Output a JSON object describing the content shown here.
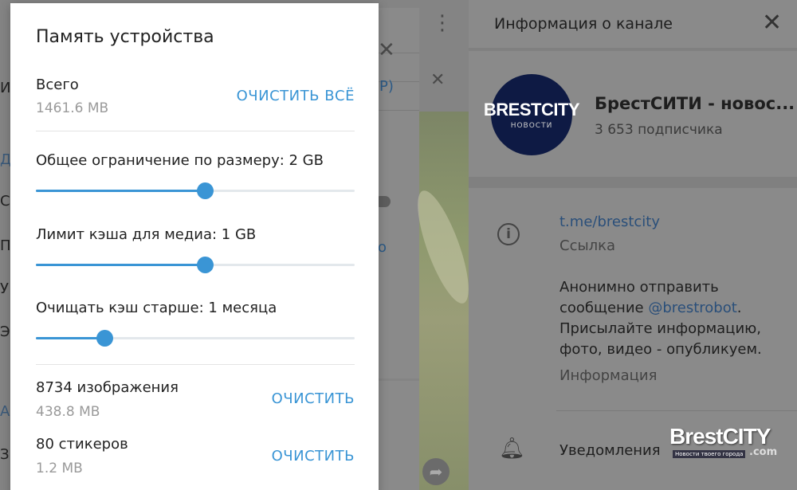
{
  "dialog": {
    "title": "Память устройства",
    "total": {
      "label": "Всего",
      "size": "1461.6 MB",
      "action": "ОЧИСТИТЬ ВСЁ"
    },
    "size_limit": {
      "label": "Общее ограничение по размеру: 2 GB",
      "value_fraction": 0.53
    },
    "media_cache": {
      "label": "Лимит кэша для медиа: 1 GB",
      "value_fraction": 0.53
    },
    "clear_older": {
      "label": "Очищать кэш старше: 1 месяца",
      "value_fraction": 0.215
    },
    "images": {
      "label": "8734 изображения",
      "size": "438.8 MB",
      "action": "ОЧИСТИТЬ"
    },
    "stickers": {
      "label": "80 стикеров",
      "size": "1.2 MB",
      "action": "ОЧИСТИТЬ"
    },
    "accent_color": "#3a95d5"
  },
  "channel_info": {
    "header_title": "Информация о канале",
    "avatar": {
      "logo_text": "BRESTCITY",
      "logo_sub": "НОВОСТИ"
    },
    "name": "БрестСИТИ - новос...",
    "subscribers": "3 653 подписчика",
    "link": "t.me/brestcity",
    "link_caption": "Ссылка",
    "description_line1": "Анонимно отправить",
    "description_prefix": "сообщение ",
    "description_mention": "@brestrobot",
    "description_suffix": ".",
    "description_line3": "Присылайте информацию,",
    "description_line4": "фото, видео - опубликуем.",
    "description_caption": "Информация",
    "notifications_label": "Уведомления"
  },
  "background": {
    "strip_chars": [
      "И",
      "Д",
      "С",
      "П",
      "У",
      "Э",
      "А",
      "З"
    ],
    "partial_link_1": "Р)",
    "partial_link_2": "о"
  },
  "watermark": {
    "text": "BrestCITY",
    "sub": "Новости твоего города",
    "dot": ".com"
  },
  "icons": {
    "close": "close-icon",
    "more": "more-vertical-icon",
    "info": "info-icon",
    "bell": "bell-icon",
    "forward": "forward-icon"
  }
}
